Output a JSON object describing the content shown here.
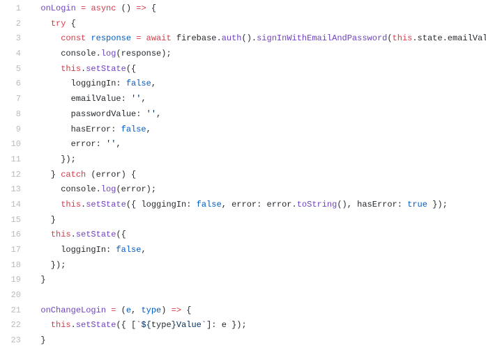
{
  "lines": [
    {
      "n": "1",
      "tokens": [
        [
          "plain",
          "  "
        ],
        [
          "fn",
          "onLogin"
        ],
        [
          "plain",
          " "
        ],
        [
          "kw",
          "="
        ],
        [
          "plain",
          " "
        ],
        [
          "kw",
          "async"
        ],
        [
          "plain",
          " () "
        ],
        [
          "kw",
          "=>"
        ],
        [
          "plain",
          " {"
        ]
      ]
    },
    {
      "n": "2",
      "tokens": [
        [
          "plain",
          "    "
        ],
        [
          "kw",
          "try"
        ],
        [
          "plain",
          " {"
        ]
      ]
    },
    {
      "n": "3",
      "tokens": [
        [
          "plain",
          "      "
        ],
        [
          "kw",
          "const"
        ],
        [
          "plain",
          " "
        ],
        [
          "id",
          "response"
        ],
        [
          "plain",
          " "
        ],
        [
          "kw",
          "="
        ],
        [
          "plain",
          " "
        ],
        [
          "kw",
          "await"
        ],
        [
          "plain",
          " firebase."
        ],
        [
          "fn",
          "auth"
        ],
        [
          "plain",
          "()."
        ],
        [
          "fn",
          "signInWithEmailAndPassword"
        ],
        [
          "plain",
          "("
        ],
        [
          "kw",
          "this"
        ],
        [
          "plain",
          ".state.emailValue"
        ]
      ]
    },
    {
      "n": "4",
      "tokens": [
        [
          "plain",
          "      console."
        ],
        [
          "fn",
          "log"
        ],
        [
          "plain",
          "(response);"
        ]
      ]
    },
    {
      "n": "5",
      "tokens": [
        [
          "plain",
          "      "
        ],
        [
          "kw",
          "this"
        ],
        [
          "plain",
          "."
        ],
        [
          "fn",
          "setState"
        ],
        [
          "plain",
          "({"
        ]
      ]
    },
    {
      "n": "6",
      "tokens": [
        [
          "plain",
          "        loggingIn: "
        ],
        [
          "id",
          "false"
        ],
        [
          "plain",
          ","
        ]
      ]
    },
    {
      "n": "7",
      "tokens": [
        [
          "plain",
          "        emailValue: "
        ],
        [
          "str",
          "''"
        ],
        [
          "plain",
          ","
        ]
      ]
    },
    {
      "n": "8",
      "tokens": [
        [
          "plain",
          "        passwordValue: "
        ],
        [
          "str",
          "''"
        ],
        [
          "plain",
          ","
        ]
      ]
    },
    {
      "n": "9",
      "tokens": [
        [
          "plain",
          "        hasError: "
        ],
        [
          "id",
          "false"
        ],
        [
          "plain",
          ","
        ]
      ]
    },
    {
      "n": "10",
      "tokens": [
        [
          "plain",
          "        error: "
        ],
        [
          "str",
          "''"
        ],
        [
          "plain",
          ","
        ]
      ]
    },
    {
      "n": "11",
      "tokens": [
        [
          "plain",
          "      });"
        ]
      ]
    },
    {
      "n": "12",
      "tokens": [
        [
          "plain",
          "    } "
        ],
        [
          "kw",
          "catch"
        ],
        [
          "plain",
          " (error) {"
        ]
      ]
    },
    {
      "n": "13",
      "tokens": [
        [
          "plain",
          "      console."
        ],
        [
          "fn",
          "log"
        ],
        [
          "plain",
          "(error);"
        ]
      ]
    },
    {
      "n": "14",
      "tokens": [
        [
          "plain",
          "      "
        ],
        [
          "kw",
          "this"
        ],
        [
          "plain",
          "."
        ],
        [
          "fn",
          "setState"
        ],
        [
          "plain",
          "({ loggingIn: "
        ],
        [
          "id",
          "false"
        ],
        [
          "plain",
          ", error: error."
        ],
        [
          "fn",
          "toString"
        ],
        [
          "plain",
          "(), hasError: "
        ],
        [
          "id",
          "true"
        ],
        [
          "plain",
          " });"
        ]
      ]
    },
    {
      "n": "15",
      "tokens": [
        [
          "plain",
          "    }"
        ]
      ]
    },
    {
      "n": "16",
      "tokens": [
        [
          "plain",
          "    "
        ],
        [
          "kw",
          "this"
        ],
        [
          "plain",
          "."
        ],
        [
          "fn",
          "setState"
        ],
        [
          "plain",
          "({"
        ]
      ]
    },
    {
      "n": "17",
      "tokens": [
        [
          "plain",
          "      loggingIn: "
        ],
        [
          "id",
          "false"
        ],
        [
          "plain",
          ","
        ]
      ]
    },
    {
      "n": "18",
      "tokens": [
        [
          "plain",
          "    });"
        ]
      ]
    },
    {
      "n": "19",
      "tokens": [
        [
          "plain",
          "  }"
        ]
      ]
    },
    {
      "n": "20",
      "tokens": [
        [
          "plain",
          ""
        ]
      ]
    },
    {
      "n": "21",
      "tokens": [
        [
          "plain",
          "  "
        ],
        [
          "fn",
          "onChangeLogin"
        ],
        [
          "plain",
          " "
        ],
        [
          "kw",
          "="
        ],
        [
          "plain",
          " ("
        ],
        [
          "id",
          "e"
        ],
        [
          "plain",
          ", "
        ],
        [
          "id",
          "type"
        ],
        [
          "plain",
          ") "
        ],
        [
          "kw",
          "=>"
        ],
        [
          "plain",
          " {"
        ]
      ]
    },
    {
      "n": "22",
      "tokens": [
        [
          "plain",
          "    "
        ],
        [
          "kw",
          "this"
        ],
        [
          "plain",
          "."
        ],
        [
          "fn",
          "setState"
        ],
        [
          "plain",
          "({ ["
        ],
        [
          "str",
          "`${"
        ],
        [
          "plain",
          "type"
        ],
        [
          "str",
          "}Value`"
        ],
        [
          "plain",
          "]: e });"
        ]
      ]
    },
    {
      "n": "23",
      "tokens": [
        [
          "plain",
          "  }"
        ]
      ]
    }
  ]
}
